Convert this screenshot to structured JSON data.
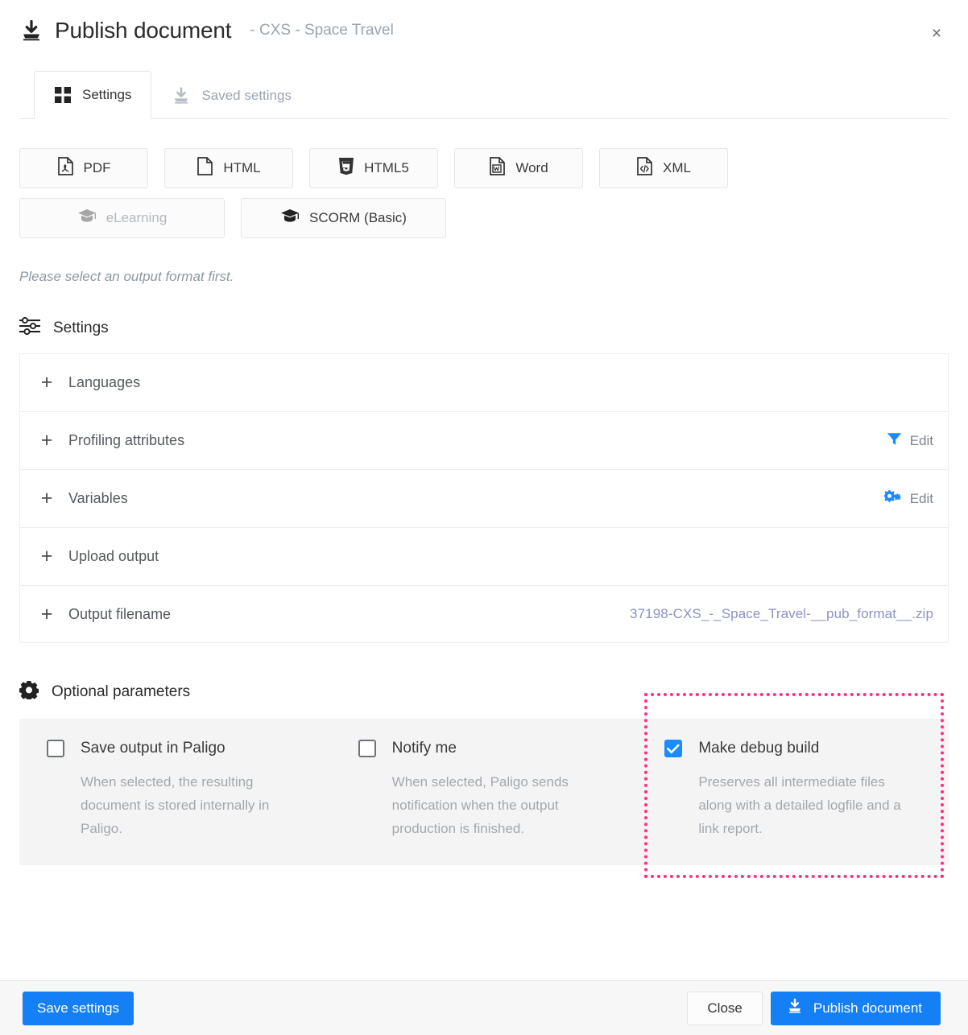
{
  "header": {
    "icon": "publish-download-icon",
    "title": "Publish document",
    "subtitle": "- CXS - Space Travel",
    "close_label": "×"
  },
  "tabs": [
    {
      "label": "Settings",
      "icon": "grid-squares-icon",
      "active": true
    },
    {
      "label": "Saved settings",
      "icon": "publish-download-icon",
      "active": false
    }
  ],
  "formats": [
    {
      "label": "PDF",
      "icon": "pdf-file-icon",
      "disabled": false
    },
    {
      "label": "HTML",
      "icon": "html-file-icon",
      "disabled": false
    },
    {
      "label": "HTML5",
      "icon": "html5-shield-icon",
      "disabled": false
    },
    {
      "label": "Word",
      "icon": "word-file-icon",
      "disabled": false
    },
    {
      "label": "XML",
      "icon": "xml-file-icon",
      "disabled": false
    },
    {
      "label": "eLearning",
      "icon": "graduation-cap-icon",
      "disabled": true
    },
    {
      "label": "SCORM (Basic)",
      "icon": "graduation-cap-icon",
      "disabled": false
    }
  ],
  "hint": "Please select an output format first.",
  "settings_section": {
    "icon": "sliders-icon",
    "title": "Settings",
    "rows": [
      {
        "label": "Languages",
        "right_type": "none",
        "right_label": ""
      },
      {
        "label": "Profiling attributes",
        "right_type": "edit",
        "right_label": "Edit",
        "right_icon": "filter-funnel-icon"
      },
      {
        "label": "Variables",
        "right_type": "edit",
        "right_label": "Edit",
        "right_icon": "gears-icon"
      },
      {
        "label": "Upload output",
        "right_type": "none",
        "right_label": ""
      },
      {
        "label": "Output filename",
        "right_type": "value",
        "right_label": "37198-CXS_-_Space_Travel-__pub_format__.zip"
      }
    ]
  },
  "optional_section": {
    "icon": "gear-icon",
    "title": "Optional parameters",
    "options": [
      {
        "label": "Save output in Paligo",
        "description": "When selected, the resulting document is stored internally in Paligo.",
        "checked": false,
        "highlighted": false
      },
      {
        "label": "Notify me",
        "description": "When selected, Paligo sends notification when the output production is finished.",
        "checked": false,
        "highlighted": false
      },
      {
        "label": "Make debug build",
        "description": "Preserves all intermediate files along with a detailed logfile and a link report.",
        "checked": true,
        "highlighted": true
      }
    ]
  },
  "footer": {
    "save_settings_label": "Save settings",
    "close_label": "Close",
    "publish_label": "Publish document",
    "publish_icon": "publish-download-icon"
  },
  "colors": {
    "primary_blue": "#157ff5",
    "checkbox_blue": "#1a8cff",
    "highlight_pink": "#ff2d87",
    "muted_text": "#9aa4b0",
    "filename_text": "#8d93c4"
  }
}
